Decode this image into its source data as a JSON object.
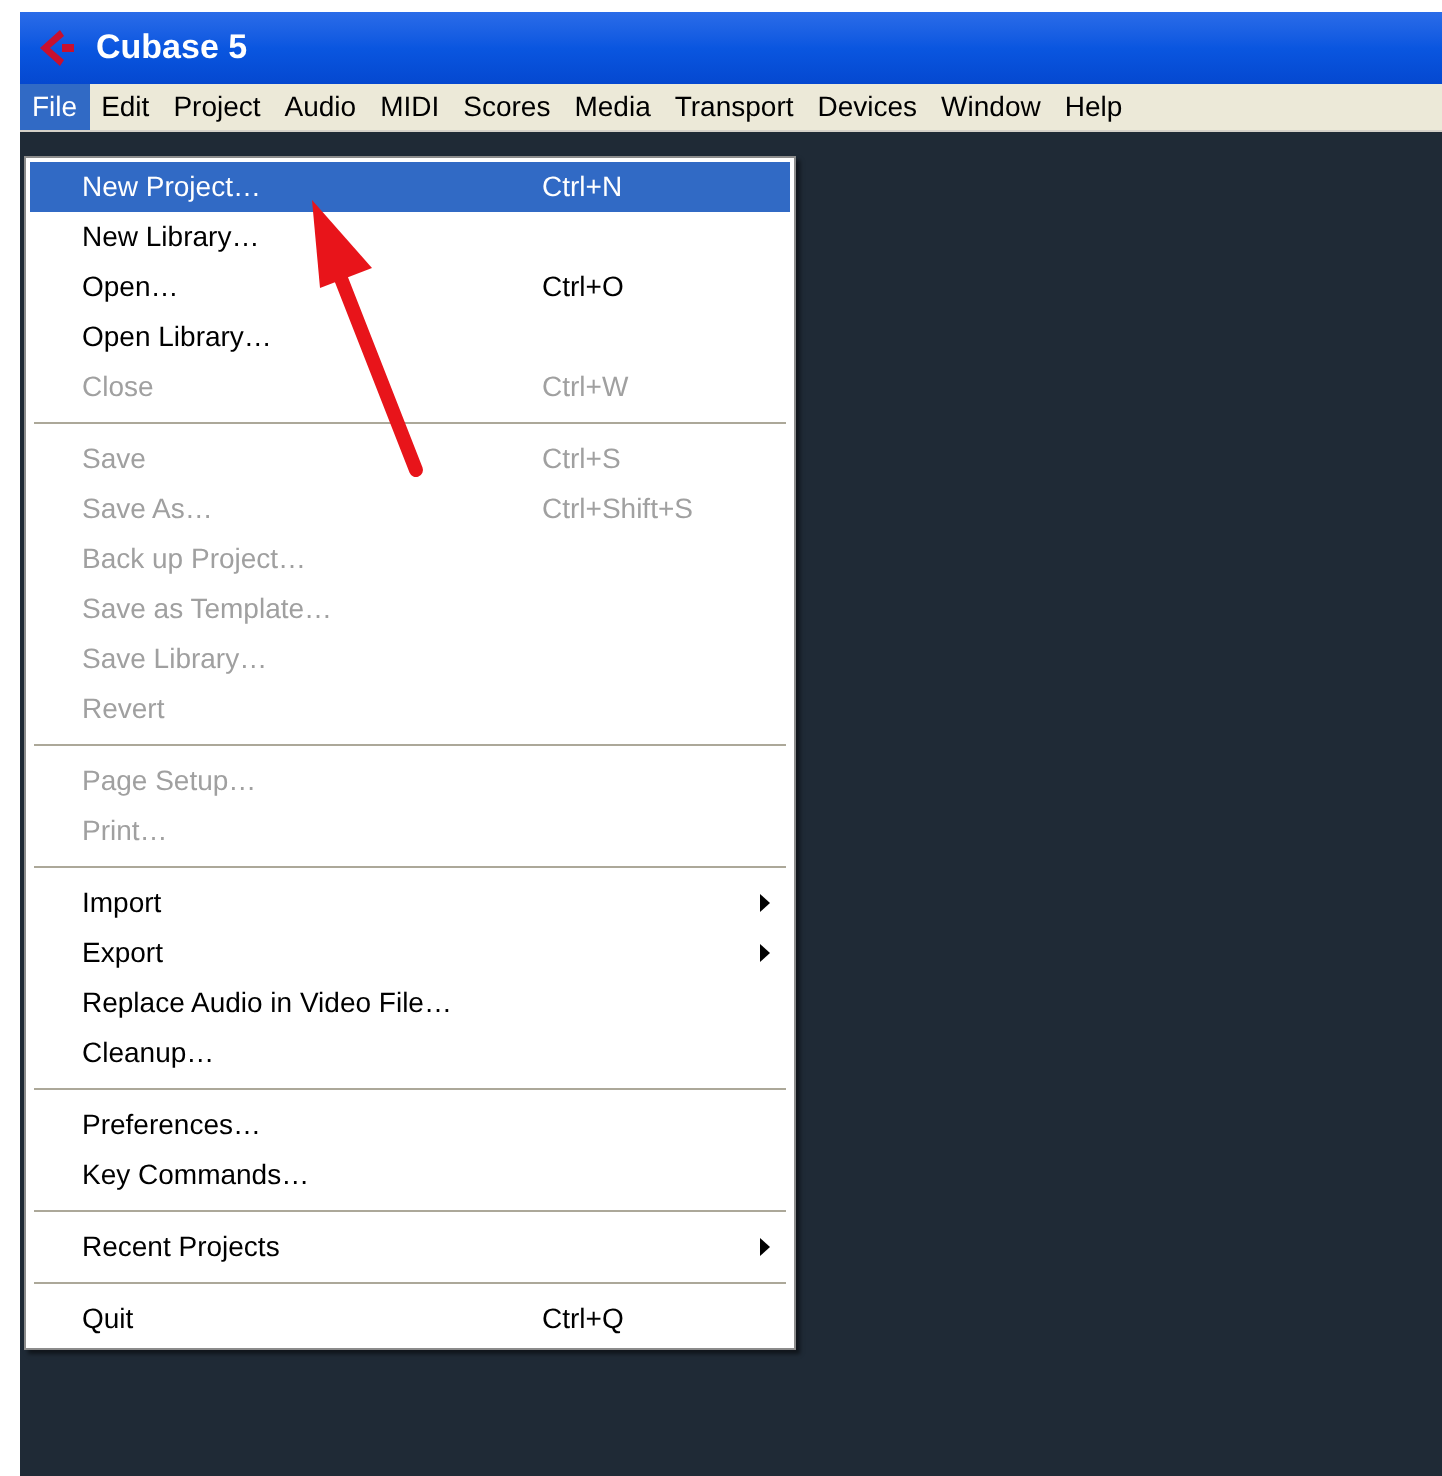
{
  "window": {
    "title": "Cubase 5"
  },
  "menu_bar": [
    {
      "label": "File",
      "selected": true
    },
    {
      "label": "Edit",
      "selected": false
    },
    {
      "label": "Project",
      "selected": false
    },
    {
      "label": "Audio",
      "selected": false
    },
    {
      "label": "MIDI",
      "selected": false
    },
    {
      "label": "Scores",
      "selected": false
    },
    {
      "label": "Media",
      "selected": false
    },
    {
      "label": "Transport",
      "selected": false
    },
    {
      "label": "Devices",
      "selected": false
    },
    {
      "label": "Window",
      "selected": false
    },
    {
      "label": "Help",
      "selected": false
    }
  ],
  "file_menu": [
    [
      {
        "label": "New Project…",
        "shortcut": "Ctrl+N",
        "disabled": false,
        "submenu": false,
        "selected": true
      },
      {
        "label": "New Library…",
        "disabled": false,
        "submenu": false,
        "selected": false
      },
      {
        "label": "Open…",
        "shortcut": "Ctrl+O",
        "disabled": false,
        "submenu": false,
        "selected": false
      },
      {
        "label": "Open Library…",
        "disabled": false,
        "submenu": false,
        "selected": false
      },
      {
        "label": "Close",
        "shortcut": "Ctrl+W",
        "disabled": true,
        "submenu": false,
        "selected": false
      }
    ],
    [
      {
        "label": "Save",
        "shortcut": "Ctrl+S",
        "disabled": true,
        "submenu": false,
        "selected": false
      },
      {
        "label": "Save As…",
        "shortcut": "Ctrl+Shift+S",
        "disabled": true,
        "submenu": false,
        "selected": false
      },
      {
        "label": "Back up Project…",
        "disabled": true,
        "submenu": false,
        "selected": false
      },
      {
        "label": "Save as Template…",
        "disabled": true,
        "submenu": false,
        "selected": false
      },
      {
        "label": "Save Library…",
        "disabled": true,
        "submenu": false,
        "selected": false
      },
      {
        "label": "Revert",
        "disabled": true,
        "submenu": false,
        "selected": false
      }
    ],
    [
      {
        "label": "Page Setup…",
        "disabled": true,
        "submenu": false,
        "selected": false
      },
      {
        "label": "Print…",
        "disabled": true,
        "submenu": false,
        "selected": false
      }
    ],
    [
      {
        "label": "Import",
        "disabled": false,
        "submenu": true,
        "selected": false
      },
      {
        "label": "Export",
        "disabled": false,
        "submenu": true,
        "selected": false
      },
      {
        "label": "Replace Audio in Video File…",
        "disabled": false,
        "submenu": false,
        "selected": false
      },
      {
        "label": "Cleanup…",
        "disabled": false,
        "submenu": false,
        "selected": false
      }
    ],
    [
      {
        "label": "Preferences…",
        "disabled": false,
        "submenu": false,
        "selected": false
      },
      {
        "label": "Key Commands…",
        "disabled": false,
        "submenu": false,
        "selected": false
      }
    ],
    [
      {
        "label": "Recent Projects",
        "disabled": false,
        "submenu": true,
        "selected": false
      }
    ],
    [
      {
        "label": "Quit",
        "shortcut": "Ctrl+Q",
        "disabled": false,
        "submenu": false,
        "selected": false
      }
    ]
  ]
}
